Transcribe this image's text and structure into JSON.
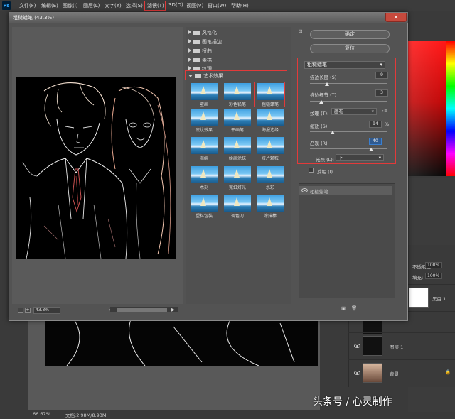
{
  "menubar": {
    "app_icon": "Ps",
    "items": [
      "文件(F)",
      "编辑(E)",
      "图像(I)",
      "图层(L)",
      "文字(Y)",
      "选择(S)",
      "滤镜(T)",
      "3D(D)",
      "视图(V)",
      "窗口(W)",
      "帮助(H)"
    ]
  },
  "dialog": {
    "title": "粗糙蜡笔 (43.3%)",
    "close_label": "✕",
    "zoom_value": "43.3%",
    "zoom_minus": "-",
    "zoom_plus": "+",
    "scroll_left": "◀",
    "scroll_right": "▶",
    "categories": [
      {
        "label": "风格化",
        "expanded": false
      },
      {
        "label": "画笔描边",
        "expanded": false
      },
      {
        "label": "扭曲",
        "expanded": false
      },
      {
        "label": "素描",
        "expanded": false
      },
      {
        "label": "纹理",
        "expanded": false
      },
      {
        "label": "艺术效果",
        "expanded": true
      }
    ],
    "filters": [
      "壁画",
      "彩色铅笔",
      "粗糙蜡笔",
      "底纹效果",
      "干画笔",
      "海报边缘",
      "海绵",
      "绘画涂抹",
      "胶片颗粒",
      "木刻",
      "霓虹灯光",
      "水彩",
      "塑料包装",
      "调色刀",
      "涂抹棒"
    ],
    "ok_label": "确定",
    "reset_label": "复位",
    "settings": {
      "filter_name": "粗糙蜡笔",
      "stroke_length_label": "描边长度 (S)",
      "stroke_length": "9",
      "stroke_detail_label": "描边细节 (T)",
      "stroke_detail": "3",
      "texture_label": "纹理 (T):",
      "texture_value": "画布",
      "scaling_label": "缩放 (S)",
      "scaling": "94",
      "scaling_unit": "%",
      "relief_label": "凸现 (R)",
      "relief": "40",
      "light_label": "光照 (L):",
      "light_value": "下",
      "invert_label": "反相 (I)"
    },
    "effect_layer_name": "粗糙蜡笔"
  },
  "layers": {
    "opacity_label": "不透明度:",
    "opacity_value": "100%",
    "fill_label": "填充:",
    "fill_value": "100%",
    "row1_name": "黑白 1",
    "row2_name": "",
    "row3_name": "图层 1",
    "row4_name": "背景"
  },
  "status": {
    "zoom": "66.67%",
    "doc_info": "文档:2.98M/8.93M"
  },
  "watermark": "头条号 / 心灵制作"
}
